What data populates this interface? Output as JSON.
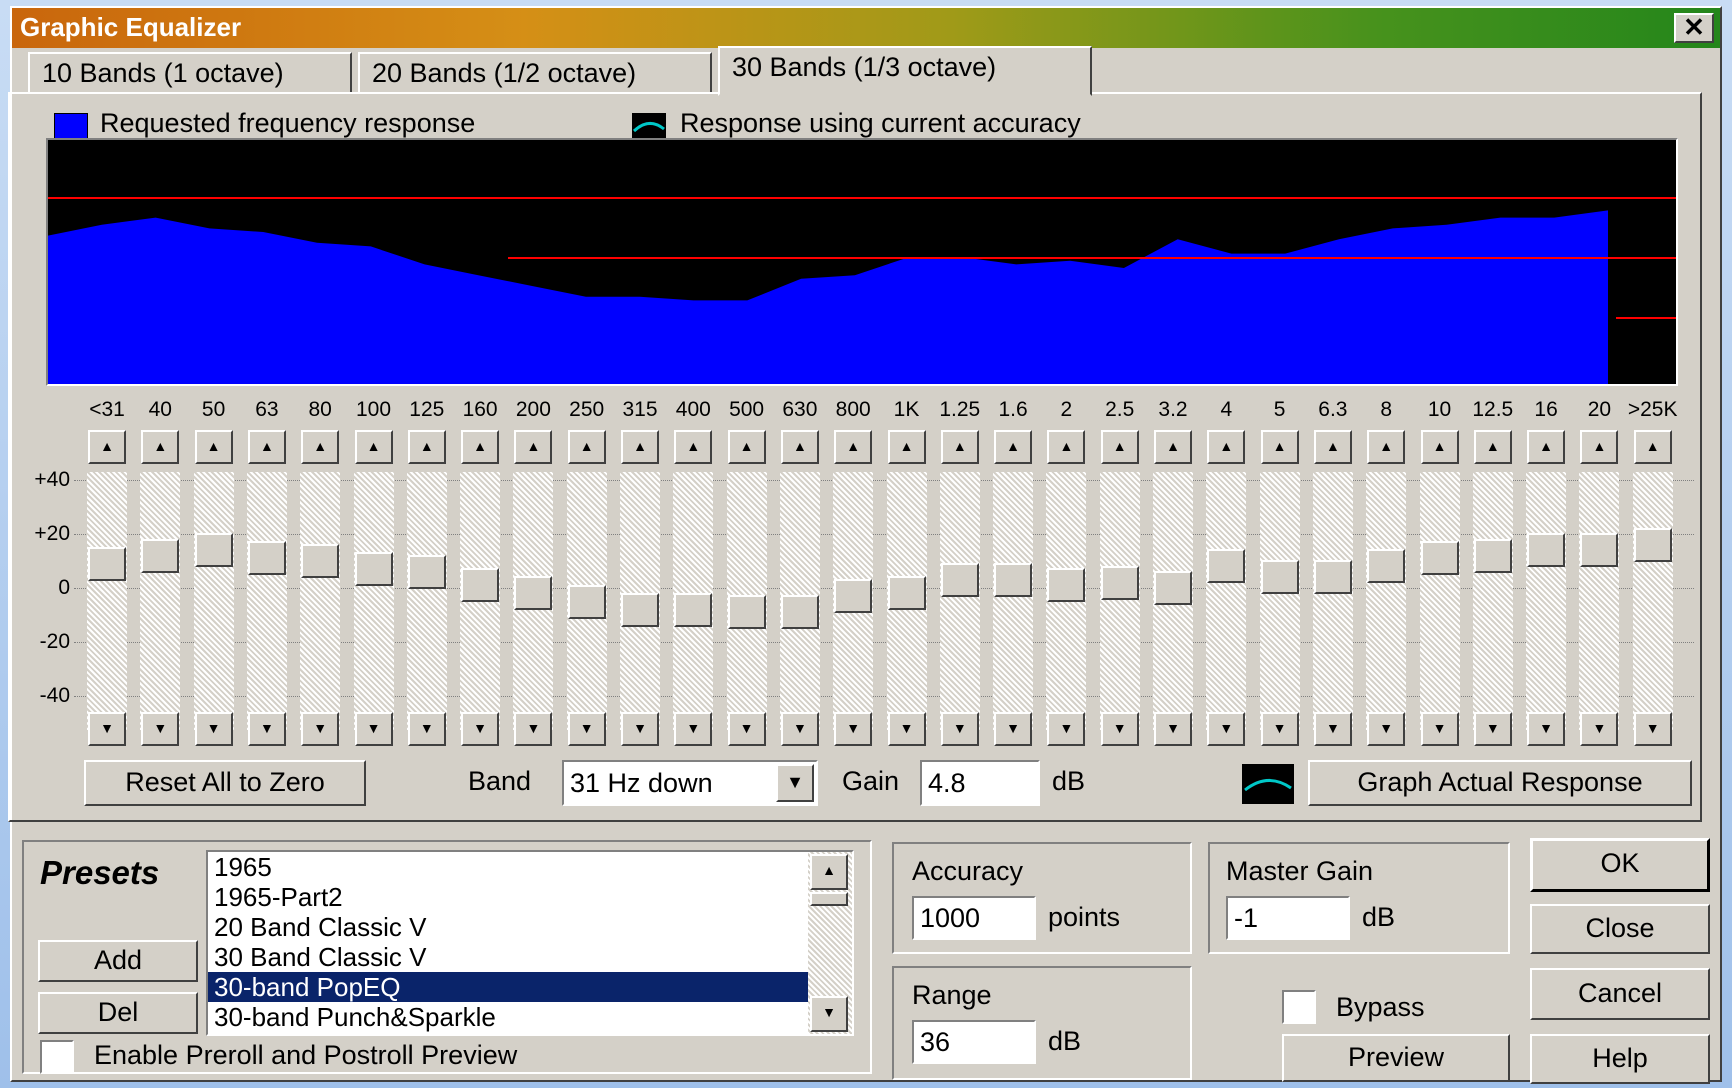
{
  "window": {
    "title": "Graphic Equalizer",
    "close_glyph": "✕"
  },
  "tabs": [
    {
      "label": "10 Bands (1 octave)"
    },
    {
      "label": "20 Bands (1/2 octave)"
    },
    {
      "label": "30 Bands (1/3 octave)",
      "active": true
    }
  ],
  "legend": {
    "requested": "Requested frequency response",
    "actual": "Response using current accuracy",
    "requested_color": "#0000ff",
    "actual_color": "#00c8c8"
  },
  "bands": {
    "labels": [
      "<31",
      "40",
      "50",
      "63",
      "80",
      "100",
      "125",
      "160",
      "200",
      "250",
      "315",
      "400",
      "500",
      "630",
      "800",
      "1K",
      "1.25",
      "1.6",
      "2",
      "2.5",
      "3.2",
      "4",
      "5",
      "6.3",
      "8",
      "10",
      "12.5",
      "16",
      "20",
      ">25K"
    ],
    "gains_db": [
      9,
      12,
      14,
      11,
      10,
      7,
      6,
      1,
      -2,
      -5,
      -8,
      -8,
      -9,
      -9,
      -3,
      -2,
      3,
      3,
      1,
      2,
      0,
      8,
      4,
      4,
      8,
      11,
      12,
      14,
      14,
      16
    ]
  },
  "y_axis": {
    "ticks": [
      "+40",
      "+20",
      "0",
      "-20",
      "-40"
    ],
    "values": [
      40,
      20,
      0,
      -20,
      -40
    ],
    "range": [
      -48,
      48
    ]
  },
  "controls": {
    "reset_label": "Reset All to Zero",
    "band_label": "Band",
    "band_value": "31 Hz down",
    "gain_label": "Gain",
    "gain_value": "4.8",
    "gain_unit": "dB",
    "graph_button": "Graph Actual Response"
  },
  "presets": {
    "heading": "Presets",
    "add": "Add",
    "del": "Del",
    "items": [
      "1965",
      "1965-Part2",
      "20 Band Classic V",
      "30 Band Classic V",
      "30-band PopEQ",
      "30-band Punch&Sparkle"
    ],
    "selected_index": 4,
    "preroll_label": "Enable Preroll and Postroll Preview"
  },
  "accuracy": {
    "label": "Accuracy",
    "value": "1000",
    "unit": "points"
  },
  "range": {
    "label": "Range",
    "value": "36",
    "unit": "dB"
  },
  "master_gain": {
    "label": "Master Gain",
    "value": "-1",
    "unit": "dB"
  },
  "bypass_label": "Bypass",
  "buttons": {
    "ok": "OK",
    "close": "Close",
    "cancel": "Cancel",
    "help": "Help",
    "preview": "Preview"
  }
}
